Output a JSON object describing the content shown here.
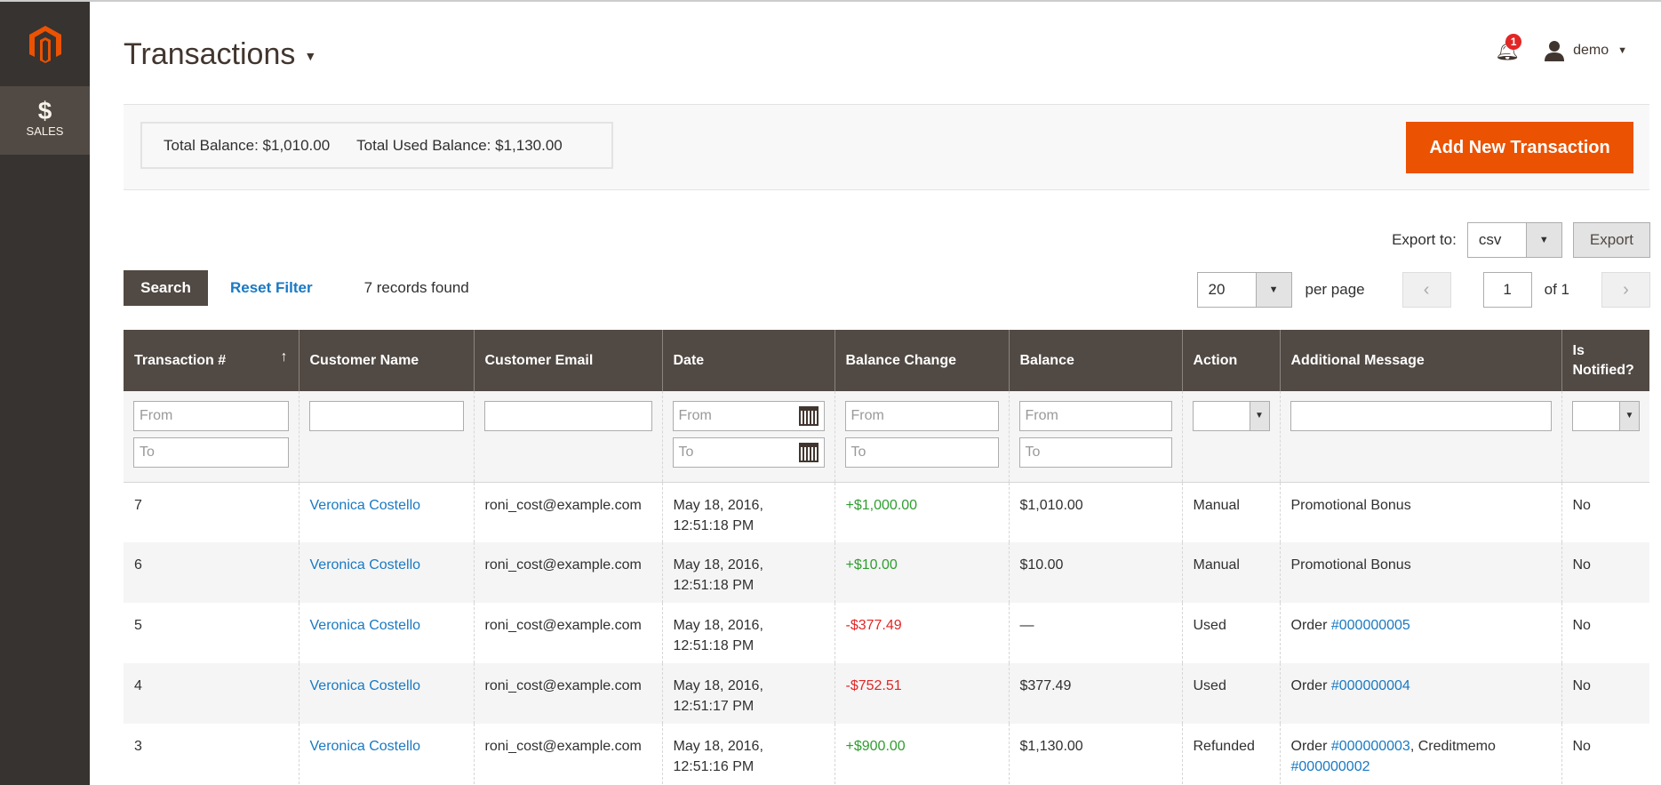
{
  "sidebar": {
    "logo": "magento-logo",
    "items": [
      {
        "label": "SALES",
        "icon": "dollar-icon"
      }
    ]
  },
  "header": {
    "title": "Transactions",
    "notifications": "1",
    "user": "demo"
  },
  "summary": {
    "total_balance_label": "Total Balance",
    "total_balance": "$1,010.00",
    "total_used_label": "Total Used Balance",
    "total_used": "$1,130.00"
  },
  "actions": {
    "add_new": "Add New Transaction",
    "export_label": "Export to:",
    "export_format": "csv",
    "export_button": "Export"
  },
  "grid": {
    "search": "Search",
    "reset": "Reset Filter",
    "records": "7 records found",
    "per_page": "20",
    "per_page_label": "per page",
    "page": "1",
    "of_pages": "of 1",
    "columns": [
      "Transaction #",
      "Customer Name",
      "Customer Email",
      "Date",
      "Balance Change",
      "Balance",
      "Action",
      "Additional Message",
      "Is Notified?"
    ],
    "filters": {
      "from": "From",
      "to": "To"
    },
    "rows": [
      {
        "id": "7",
        "name": "Veronica Costello",
        "email": "roni_cost@example.com",
        "date1": "May 18, 2016,",
        "date2": "12:51:18 PM",
        "change": "+$1,000.00",
        "sign": "pos",
        "balance": "$1,010.00",
        "action": "Manual",
        "msg": "Promotional Bonus",
        "notified": "No"
      },
      {
        "id": "6",
        "name": "Veronica Costello",
        "email": "roni_cost@example.com",
        "date1": "May 18, 2016,",
        "date2": "12:51:18 PM",
        "change": "+$10.00",
        "sign": "pos",
        "balance": "$10.00",
        "action": "Manual",
        "msg": "Promotional Bonus",
        "notified": "No"
      },
      {
        "id": "5",
        "name": "Veronica Costello",
        "email": "roni_cost@example.com",
        "date1": "May 18, 2016,",
        "date2": "12:51:18 PM",
        "change": "-$377.49",
        "sign": "neg",
        "balance": "—",
        "action": "Used",
        "msg": "Order ",
        "link1": "#000000005",
        "notified": "No"
      },
      {
        "id": "4",
        "name": "Veronica Costello",
        "email": "roni_cost@example.com",
        "date1": "May 18, 2016,",
        "date2": "12:51:17 PM",
        "change": "-$752.51",
        "sign": "neg",
        "balance": "$377.49",
        "action": "Used",
        "msg": "Order ",
        "link1": "#000000004",
        "notified": "No"
      },
      {
        "id": "3",
        "name": "Veronica Costello",
        "email": "roni_cost@example.com",
        "date1": "May 18, 2016,",
        "date2": "12:51:16 PM",
        "change": "+$900.00",
        "sign": "pos",
        "balance": "$1,130.00",
        "action": "Refunded",
        "msg": "Order ",
        "link1": "#000000003",
        "mid": ", Creditmemo ",
        "link2": "#000000002",
        "notified": "No"
      }
    ]
  },
  "colors": {
    "accent": "#eb5202",
    "header_bg": "#514943",
    "sidebar_bg": "#373330",
    "link": "#1979c3",
    "positive": "#2f9e2f",
    "negative": "#e22626"
  }
}
